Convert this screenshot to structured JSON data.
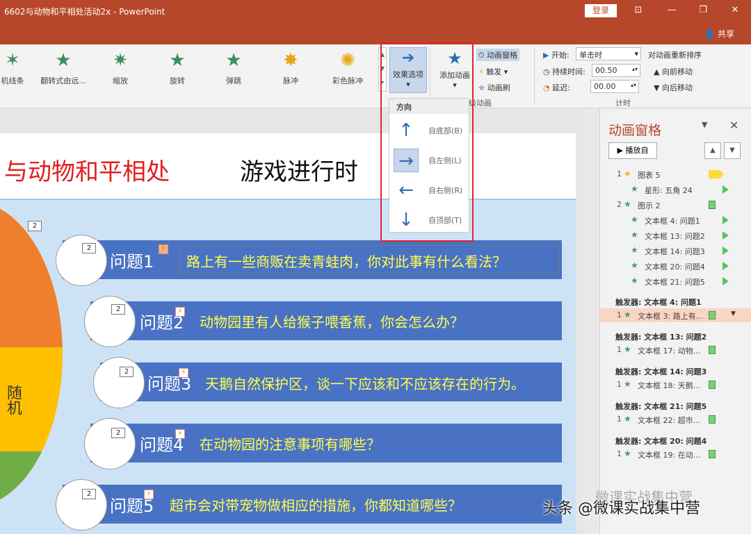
{
  "window": {
    "title": "6602与动物和平相处活动2x  -  PowerPoint",
    "login": "登录",
    "share": "共享"
  },
  "ribbon": {
    "gallery": [
      {
        "label": "机线条",
        "icon": "star-line-icon"
      },
      {
        "label": "翻转式由远...",
        "icon": "star-flip-icon"
      },
      {
        "label": "缩放",
        "icon": "star-zoom-icon"
      },
      {
        "label": "旋转",
        "icon": "star-spin-icon"
      },
      {
        "label": "弹跳",
        "icon": "star-bounce-icon"
      },
      {
        "label": "脉冲",
        "icon": "star-pulse-icon"
      },
      {
        "label": "彩色脉冲",
        "icon": "star-color-pulse-icon"
      }
    ],
    "effect_options": "效果选项",
    "add_animation": "添加动画",
    "advanced": {
      "pane": "动画窗格",
      "trigger": "触发",
      "painter": "动画刷",
      "group": "级动画"
    },
    "timing": {
      "start_label": "开始:",
      "start_value": "单击时",
      "duration_label": "持续时间:",
      "duration_value": "00.50",
      "delay_label": "延迟:",
      "delay_value": "00.00",
      "group": "计时"
    },
    "reorder": {
      "title": "对动画重新排序",
      "forward": "向前移动",
      "backward": "向后移动"
    }
  },
  "dropdown": {
    "header": "方向",
    "items": [
      {
        "label": "自底部(B)",
        "arrow": "↑",
        "icon": "arrow-up-icon"
      },
      {
        "label": "自左侧(L)",
        "arrow": "→",
        "icon": "arrow-right-icon",
        "selected": true
      },
      {
        "label": "自右侧(R)",
        "arrow": "←",
        "icon": "arrow-left-icon"
      },
      {
        "label": "自顶部(T)",
        "arrow": "↓",
        "icon": "arrow-down-icon"
      }
    ]
  },
  "slide": {
    "title": "与动物和平相处",
    "subtitle": "游戏进行时",
    "pie_text": "随机",
    "badge_top": "2",
    "questions": [
      {
        "label": "问题1",
        "text": "路上有一些商贩在卖青蛙肉，你对此事有什么看法？",
        "badge": "2"
      },
      {
        "label": "问题2",
        "text": "动物园里有人给猴子喂香蕉，你会怎么办？",
        "badge": "2"
      },
      {
        "label": "问题3",
        "text": "天鹅自然保护区，谈一下应该和不应该存在的行为。",
        "badge": "2"
      },
      {
        "label": "问题4",
        "text": "在动物园的注意事项有哪些？",
        "badge": "2"
      },
      {
        "label": "问题5",
        "text": "超市会对带宠物做相应的措施，你都知道哪些？",
        "badge": "2"
      }
    ]
  },
  "pane": {
    "title": "动画窗格",
    "play": "播放自",
    "up": "▲",
    "down": "▼",
    "items": [
      {
        "num": "1",
        "name": "图表 5",
        "star": "★",
        "star_color": "#f0b030",
        "marker": "flag"
      },
      {
        "num": "",
        "name": "星形: 五角 24",
        "star": "★",
        "star_color": "#4a9a6a",
        "marker": "play"
      },
      {
        "num": "2",
        "name": "图示 2",
        "star": "★",
        "star_color": "#4a9a6a",
        "marker": "box"
      },
      {
        "num": "",
        "name": "文本框 4: 问题1",
        "star": "★",
        "star_color": "#4a9a6a",
        "marker": "play"
      },
      {
        "num": "",
        "name": "文本框 13: 问题2",
        "star": "★",
        "star_color": "#4a9a6a",
        "marker": "play"
      },
      {
        "num": "",
        "name": "文本框 14: 问题3",
        "star": "★",
        "star_color": "#4a9a6a",
        "marker": "play"
      },
      {
        "num": "",
        "name": "文本框 20: 问题4",
        "star": "★",
        "star_color": "#4a9a6a",
        "marker": "play"
      },
      {
        "num": "",
        "name": "文本框 21: 问题5",
        "star": "★",
        "star_color": "#4a9a6a",
        "marker": "play"
      }
    ],
    "triggers": [
      {
        "head": "触发器: 文本框 4: 问题1",
        "num": "1",
        "name": "文本框 3: 路上有...",
        "selected": true
      },
      {
        "head": "触发器: 文本框 13: 问题2",
        "num": "1",
        "name": "文本框 17: 动物..."
      },
      {
        "head": "触发器: 文本框 14: 问题3",
        "num": "1",
        "name": "文本框 18: 天鹅..."
      },
      {
        "head": "触发器: 文本框 21: 问题5",
        "num": "1",
        "name": "文本框 22: 超市..."
      },
      {
        "head": "触发器: 文本框 20: 问题4",
        "num": "1",
        "name": "文本框 19: 在动..."
      }
    ]
  },
  "watermark": "头条 @微课实战集中营",
  "watermark_logo": "微课实战集中营"
}
